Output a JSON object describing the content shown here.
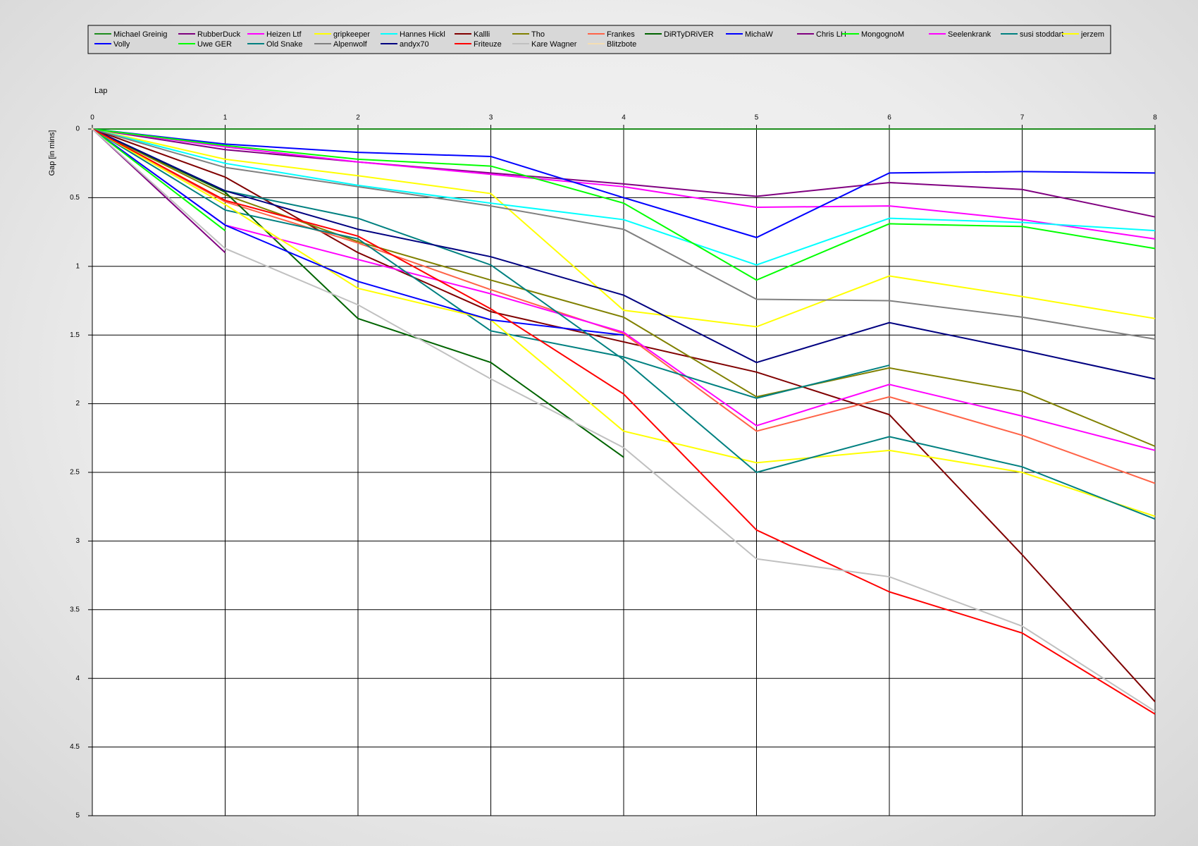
{
  "chart_data": {
    "type": "line",
    "x_axis_label": "Lap",
    "y_axis_label": "Gap [in mins]",
    "x_ticks": [
      "0",
      "1",
      "2",
      "3",
      "4",
      "5",
      "6",
      "7",
      "8"
    ],
    "y_ticks": [
      "0",
      "0.5",
      "1",
      "1.5",
      "2",
      "2.5",
      "3",
      "3.5",
      "4",
      "4.5",
      "5"
    ],
    "xlim": [
      0,
      8
    ],
    "ylim": [
      0,
      5
    ],
    "y_inverted": true,
    "grid": true,
    "legend_position": "top",
    "series": [
      {
        "name": "Michael Greinig",
        "color": "#1e8c1e",
        "values": [
          0,
          0,
          0,
          0,
          0,
          0,
          0,
          0,
          0
        ]
      },
      {
        "name": "RubberDuck",
        "color": "#800080",
        "values": [
          0,
          0.15,
          0.24,
          0.32,
          0.4,
          0.49,
          0.39,
          0.44,
          0.64
        ]
      },
      {
        "name": "Heizen Ltf",
        "color": "#ff00ff",
        "values": [
          0,
          0.13,
          0.24,
          0.33,
          0.42,
          0.57,
          0.56,
          0.66,
          0.8
        ]
      },
      {
        "name": "gripkeeper",
        "color": "#ffff00",
        "values": [
          0,
          0.22,
          0.34,
          0.47,
          1.32,
          1.44,
          1.07,
          1.22,
          1.38
        ]
      },
      {
        "name": "Hannes Hickl",
        "color": "#00ffff",
        "values": [
          0,
          0.25,
          0.41,
          0.54,
          0.66,
          0.99,
          0.65,
          0.68,
          0.74
        ]
      },
      {
        "name": "Kallli",
        "color": "#800000",
        "values": [
          0,
          0.35,
          0.9,
          1.33,
          1.55,
          1.77,
          2.08,
          3.1,
          4.17
        ]
      },
      {
        "name": "Tho",
        "color": "#808000",
        "values": [
          0,
          0.48,
          0.82,
          1.1,
          1.37,
          1.95,
          1.74,
          1.91,
          2.31
        ]
      },
      {
        "name": "Frankes",
        "color": "#ff6347",
        "values": [
          0,
          0.53,
          0.83,
          1.17,
          1.49,
          2.2,
          1.95,
          2.23,
          2.58
        ]
      },
      {
        "name": "DiRTyDRiVER",
        "color": "#006400",
        "values": [
          0,
          0.46,
          1.38,
          1.7,
          2.39
        ]
      },
      {
        "name": "MichaW",
        "color": "#0000ff",
        "values": [
          0,
          0.11,
          0.17,
          0.2,
          0.5,
          0.79,
          0.32,
          0.31,
          0.32
        ]
      },
      {
        "name": "Chris LH",
        "color": "#800080",
        "values": [
          0,
          0.9
        ]
      },
      {
        "name": "MongognoM",
        "color": "#00ff00",
        "values": [
          0,
          0.12,
          0.22,
          0.27,
          0.54,
          1.1,
          0.69,
          0.71,
          0.87
        ]
      },
      {
        "name": "Seelenkrank",
        "color": "#ff00ff",
        "values": [
          0,
          0.7,
          0.95,
          1.2,
          1.48,
          2.16,
          1.86,
          2.09,
          2.34
        ]
      },
      {
        "name": "susi stoddart",
        "color": "#008080",
        "values": [
          0,
          0.59,
          0.8,
          1.47,
          1.66,
          1.96,
          1.72
        ]
      },
      {
        "name": "jerzem",
        "color": "#ffff00",
        "values": [
          0,
          0.55,
          1.16,
          1.39,
          2.2,
          2.43,
          2.34,
          2.5,
          2.82
        ]
      },
      {
        "name": "Volly",
        "color": "#0000ff",
        "values": [
          0,
          0.7,
          1.11,
          1.39,
          1.5
        ]
      },
      {
        "name": "Uwe GER",
        "color": "#00ff00",
        "values": [
          0,
          0.74
        ]
      },
      {
        "name": "Old Snake",
        "color": "#008080",
        "values": [
          0,
          0.45,
          0.65,
          0.99,
          1.68,
          2.5,
          2.24,
          2.46,
          2.84
        ]
      },
      {
        "name": "Alpenwolf",
        "color": "#808080",
        "values": [
          0,
          0.28,
          0.42,
          0.56,
          0.73,
          1.24,
          1.25,
          1.37,
          1.53
        ]
      },
      {
        "name": "andyx70",
        "color": "#000080",
        "values": [
          0,
          0.45,
          0.73,
          0.93,
          1.21,
          1.7,
          1.41,
          1.61,
          1.82
        ]
      },
      {
        "name": "Friteuze",
        "color": "#ff0000",
        "values": [
          0,
          0.52,
          0.78,
          1.31,
          1.93,
          2.92,
          3.37,
          3.67,
          4.26
        ]
      },
      {
        "name": "Kare Wagner",
        "color": "#c0c0c0",
        "values": [
          0,
          0.87,
          1.28,
          1.82,
          2.32,
          3.13,
          3.26,
          3.62,
          4.24
        ]
      },
      {
        "name": "Blitzbote",
        "color": "#f5deb3",
        "values": [
          0
        ]
      }
    ]
  }
}
